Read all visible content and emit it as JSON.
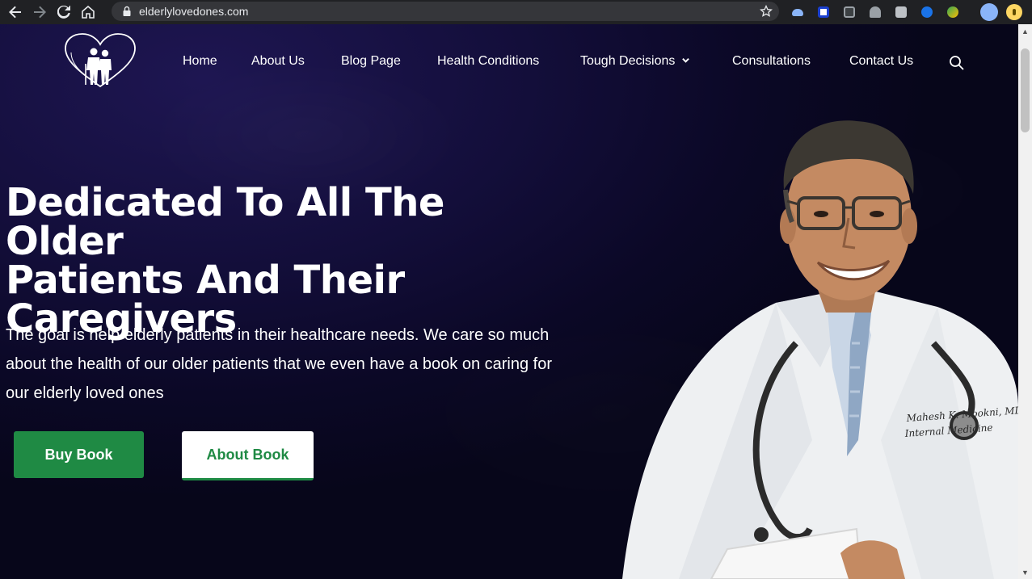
{
  "browser": {
    "url": "elderlylovedones.com"
  },
  "site": {
    "logo": "elderly-loved-ones-logo",
    "nav": [
      {
        "label": "Home"
      },
      {
        "label": "About Us"
      },
      {
        "label": "Blog Page"
      },
      {
        "label": "Health Conditions"
      },
      {
        "label": "Tough Decisions"
      },
      {
        "label": "Consultations"
      },
      {
        "label": "Contact Us"
      }
    ]
  },
  "hero": {
    "title_line1": "Dedicated To All The Older",
    "title_line2": "Patients And Their",
    "title_line3": "Caregivers",
    "text": "The goal is help elderly patients in their healthcare needs. We care so much about the health of our older patients that we even have a book on caring for our elderly loved ones",
    "primary_button": "Buy Book",
    "secondary_button": "About Book"
  },
  "doctor": {
    "coat_name": "Mahesh K. Mookni, MD",
    "coat_title": "Internal Medicine"
  },
  "colors": {
    "accent_green": "#1f8a44",
    "page_bg": "#0d0a2a",
    "text": "#ffffff"
  }
}
